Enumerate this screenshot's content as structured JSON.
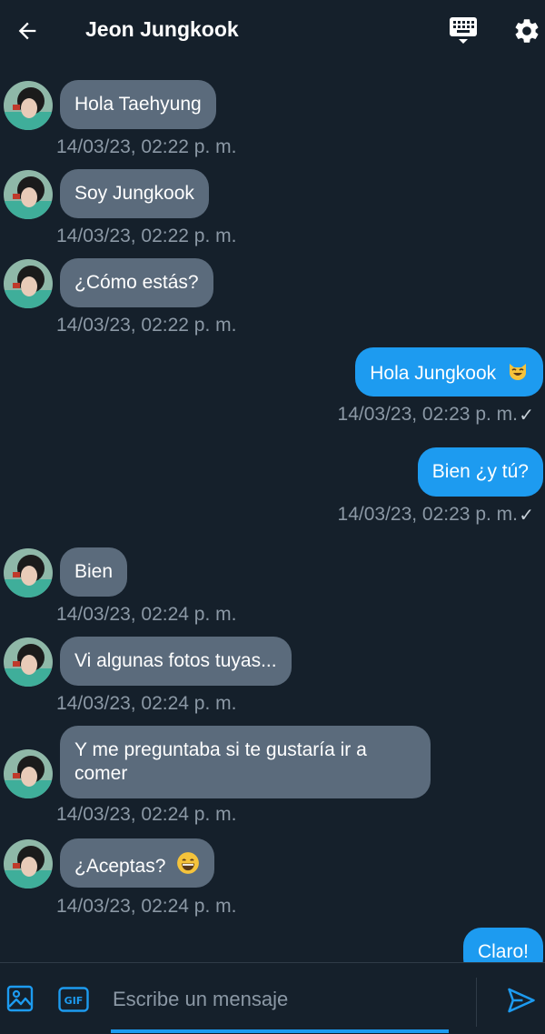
{
  "header": {
    "title": "Jeon Jungkook"
  },
  "messages": [
    {
      "text": "Hola Taehyung",
      "time": "14/03/23, 02:22 p. m."
    },
    {
      "text": "Soy Jungkook",
      "time": "14/03/23, 02:22 p. m."
    },
    {
      "text": "¿Cómo estás?",
      "time": "14/03/23, 02:22 p. m."
    },
    {
      "text": "Hola Jungkook",
      "time": "14/03/23, 02:23 p. m.",
      "emoji": "cat-face-emoji"
    },
    {
      "text": "Bien ¿y tú?",
      "time": "14/03/23, 02:23 p. m."
    },
    {
      "text": "Bien",
      "time": "14/03/23, 02:24 p. m."
    },
    {
      "text": "Vi algunas fotos tuyas...",
      "time": "14/03/23, 02:24 p. m."
    },
    {
      "text": "Y me preguntaba si te gustaría ir a comer",
      "time": "14/03/23, 02:24 p. m."
    },
    {
      "text": "¿Aceptas?",
      "time": "14/03/23, 02:24 p. m.",
      "emoji": "grinning-face-emoji"
    },
    {
      "text": "Claro!"
    }
  ],
  "composer": {
    "placeholder": "Escribe un mensaje",
    "gif_label": "GIF"
  },
  "icons": {
    "back": "arrow-left-icon",
    "keyboard": "keyboard-icon",
    "settings": "gear-icon",
    "image": "image-icon",
    "gif": "gif-icon",
    "send": "send-icon",
    "read": "check-icon"
  },
  "colors": {
    "background": "#15202b",
    "incoming_bubble": "#5b6b7c",
    "outgoing_bubble": "#1d9bf0",
    "timestamp": "#8b98a5",
    "accent": "#1d9bf0"
  }
}
